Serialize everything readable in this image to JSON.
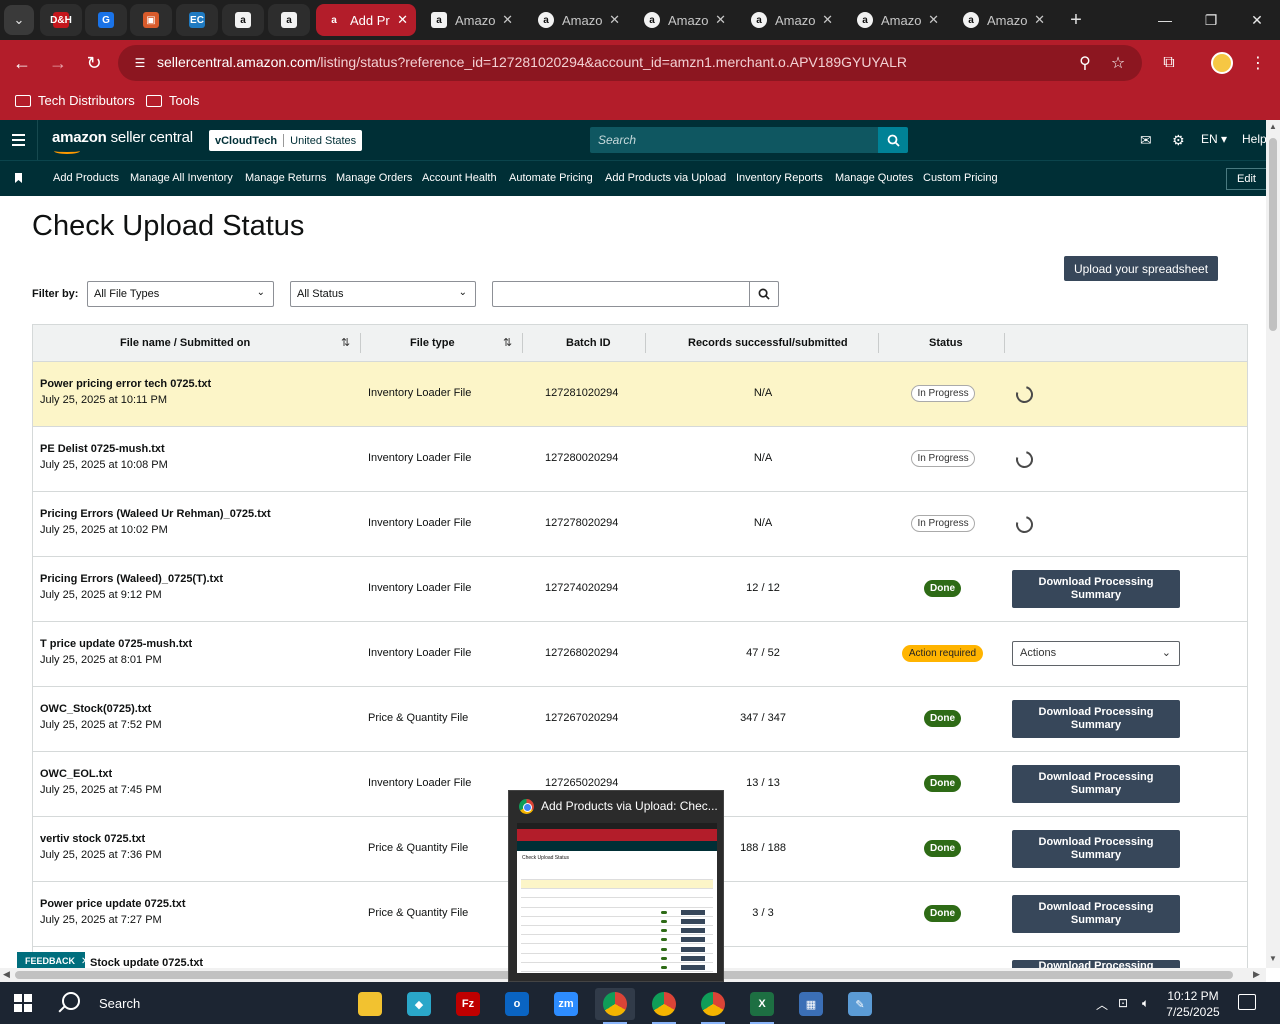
{
  "browser": {
    "tab_search_icon": "chevron-down-icon",
    "pinned_tabs": [
      {
        "icon": "dell-icon",
        "label": "D&H",
        "color": "#c4161c"
      },
      {
        "icon": "app-g-icon",
        "label": "G",
        "color": "#1a73e8"
      },
      {
        "icon": "box-icon",
        "label": "▣",
        "color": "#d95b2b"
      },
      {
        "icon": "ec-icon",
        "label": "EC",
        "color": "#1f7ac1"
      },
      {
        "icon": "amazon-icon",
        "label": "a",
        "color": "#f2f2f2"
      },
      {
        "icon": "amazon-icon",
        "label": "a",
        "color": "#f2f2f2"
      }
    ],
    "tabs": [
      {
        "title": "Add Pr",
        "active": true
      },
      {
        "title": "Amazo",
        "active": false
      },
      {
        "title": "Amazo",
        "active": false
      },
      {
        "title": "Amazo",
        "active": false
      },
      {
        "title": "Amazo",
        "active": false
      },
      {
        "title": "Amazo",
        "active": false
      },
      {
        "title": "Amazo",
        "active": false
      }
    ],
    "url_host": "sellercentral.amazon.com",
    "url_path": "/listing/status?reference_id=127281020294&account_id=amzn1.merchant.o.APV189GYUYALR",
    "bookmarks": [
      "Tech Distributors",
      "Tools"
    ],
    "accent": "#b31d2a"
  },
  "seller_header": {
    "logo_text_bold": "amazon",
    "logo_text": " seller central",
    "account_name": "vCloudTech",
    "account_region": "United States",
    "search_placeholder": "Search",
    "language": "EN",
    "help": "Help"
  },
  "nav": {
    "items": [
      "Add Products",
      "Manage All Inventory",
      "Manage Returns",
      "Manage Orders",
      "Account Health",
      "Automate Pricing",
      "Add Products via Upload",
      "Inventory Reports",
      "Manage Quotes",
      "Custom Pricing"
    ],
    "edit_label": "Edit"
  },
  "page": {
    "title": "Check Upload Status",
    "upload_button": "Upload your spreadsheet",
    "filter_label": "Filter by:",
    "file_type_filter": "All File Types",
    "status_filter": "All Status",
    "search_value": ""
  },
  "table": {
    "headers": {
      "file": "File name / Submitted on",
      "type": "File type",
      "batch": "Batch ID",
      "records": "Records successful/submitted",
      "status": "Status"
    },
    "rows": [
      {
        "name": "Power pricing error tech 0725.txt",
        "date": "July 25, 2025 at 10:11 PM",
        "type": "Inventory Loader File",
        "batch": "127281020294",
        "records": "N/A",
        "status": "In Progress",
        "kind": "progress",
        "action": ""
      },
      {
        "name": "PE Delist 0725-mush.txt",
        "date": "July 25, 2025 at 10:08 PM",
        "type": "Inventory Loader File",
        "batch": "127280020294",
        "records": "N/A",
        "status": "In Progress",
        "kind": "progress",
        "action": ""
      },
      {
        "name": "Pricing Errors (Waleed Ur Rehman)_0725.txt",
        "date": "July 25, 2025 at 10:02 PM",
        "type": "Inventory Loader File",
        "batch": "127278020294",
        "records": "N/A",
        "status": "In Progress",
        "kind": "progress",
        "action": ""
      },
      {
        "name": "Pricing Errors (Waleed)_0725(T).txt",
        "date": "July 25, 2025 at 9:12 PM",
        "type": "Inventory Loader File",
        "batch": "127274020294",
        "records": "12 / 12",
        "status": "Done",
        "kind": "done",
        "action": "Download Processing Summary"
      },
      {
        "name": "T price update 0725-mush.txt",
        "date": "July 25, 2025 at 8:01 PM",
        "type": "Inventory Loader File",
        "batch": "127268020294",
        "records": "47 / 52",
        "status": "Action required",
        "kind": "action",
        "action": "Actions"
      },
      {
        "name": "OWC_Stock(0725).txt",
        "date": "July 25, 2025 at 7:52 PM",
        "type": "Price & Quantity File",
        "batch": "127267020294",
        "records": "347 / 347",
        "status": "Done",
        "kind": "done",
        "action": "Download Processing Summary"
      },
      {
        "name": "OWC_EOL.txt",
        "date": "July 25, 2025 at 7:45 PM",
        "type": "Inventory Loader File",
        "batch": "127265020294",
        "records": "13 / 13",
        "status": "Done",
        "kind": "done",
        "action": "Download Processing Summary"
      },
      {
        "name": "vertiv stock 0725.txt",
        "date": "July 25, 2025 at 7:36 PM",
        "type": "Price & Quantity File",
        "batch": "",
        "records": "188 / 188",
        "status": "Done",
        "kind": "done",
        "action": "Download Processing Summary"
      },
      {
        "name": "Power price update 0725.txt",
        "date": "July 25, 2025 at 7:27 PM",
        "type": "Price & Quantity File",
        "batch": "",
        "records": "3 / 3",
        "status": "Done",
        "kind": "done",
        "action": "Download Processing Summary"
      },
      {
        "name": "Stock update 0725.txt",
        "date": "",
        "type": "",
        "batch": "",
        "records": "",
        "status": "",
        "kind": "partial",
        "action": "Download Processing"
      }
    ]
  },
  "feedback": "FEEDBACK",
  "preview": {
    "title": "Add Products via Upload: Chec...",
    "thumb_title": "Check Upload Status"
  },
  "taskbar": {
    "search": "Search",
    "apps": [
      {
        "icon": "file-explorer-icon",
        "label": "",
        "color": "#f2c230"
      },
      {
        "icon": "app-diamond-icon",
        "label": "◆",
        "color": "#2aa7c9"
      },
      {
        "icon": "filezilla-icon",
        "label": "Fz",
        "color": "#bf0000"
      },
      {
        "icon": "outlook-icon",
        "label": "o",
        "color": "#0a64c2"
      },
      {
        "icon": "zoom-icon",
        "label": "zm",
        "color": "#2d8cff"
      },
      {
        "icon": "chrome-icon",
        "label": "",
        "color": "#4285f4"
      },
      {
        "icon": "chrome-icon",
        "label": "",
        "color": "#4285f4"
      },
      {
        "icon": "chrome-icon",
        "label": "",
        "color": "#4285f4"
      },
      {
        "icon": "excel-icon",
        "label": "X",
        "color": "#1d6f42"
      },
      {
        "icon": "calculator-icon",
        "label": "▦",
        "color": "#3b6fb6"
      },
      {
        "icon": "app-pen-icon",
        "label": "✎",
        "color": "#5b9bd5"
      }
    ],
    "time": "10:12 PM",
    "date": "7/25/2025"
  }
}
